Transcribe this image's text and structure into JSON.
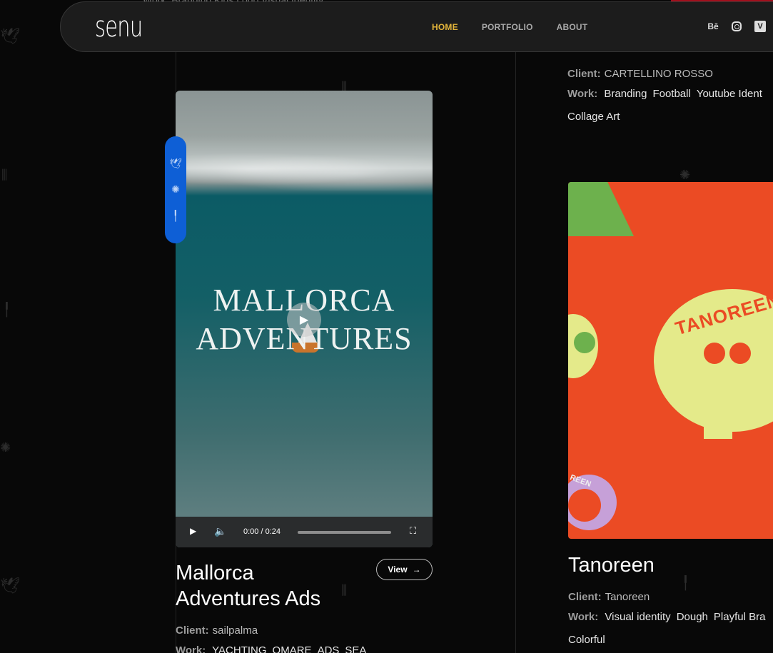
{
  "header": {
    "logo": "senu",
    "nav": [
      {
        "label": "HOME",
        "active": true
      },
      {
        "label": "PORTFOLIO",
        "active": false
      },
      {
        "label": "ABOUT",
        "active": false
      }
    ],
    "social": {
      "behance": "Bē",
      "vimeo": "V"
    }
  },
  "peek": {
    "text": "Work:  Branding  Kids Logo  Visual Identity"
  },
  "left_card": {
    "video_title_line1": "MALLORCA",
    "video_title_line2": "ADVENTURES",
    "video_time": "0:00 / 0:24",
    "title_line1": "Mallorca",
    "title_line2": "Adventures Ads",
    "view_label": "View",
    "client_label": "Client:",
    "client_value": "sailpalma",
    "work_label": "Work:",
    "work_tags": [
      "YACHTING",
      "OMARE",
      "ADS",
      "SEA"
    ]
  },
  "right_top": {
    "client_label": "Client:",
    "client_value": "CARTELLINO ROSSO",
    "work_label": "Work:",
    "work_tags": [
      "Branding",
      "Football",
      "Youtube Ident"
    ],
    "work_tags_line2": [
      "Collage Art"
    ]
  },
  "right_card": {
    "image_word": "TANOREEN",
    "image_badge": "REEN",
    "title": "Tanoreen",
    "client_label": "Client:",
    "client_value": "Tanoreen",
    "work_label": "Work:",
    "work_tags": [
      "Visual identity",
      "Dough",
      "Playful Bra"
    ],
    "work_tags_line2": [
      "Colorful"
    ]
  },
  "colors": {
    "accent": "#e3b53a",
    "pill": "#0e5fd6",
    "tanoreen_bg": "#eb4b24",
    "tanoreen_yellow": "#e4ea8a"
  }
}
